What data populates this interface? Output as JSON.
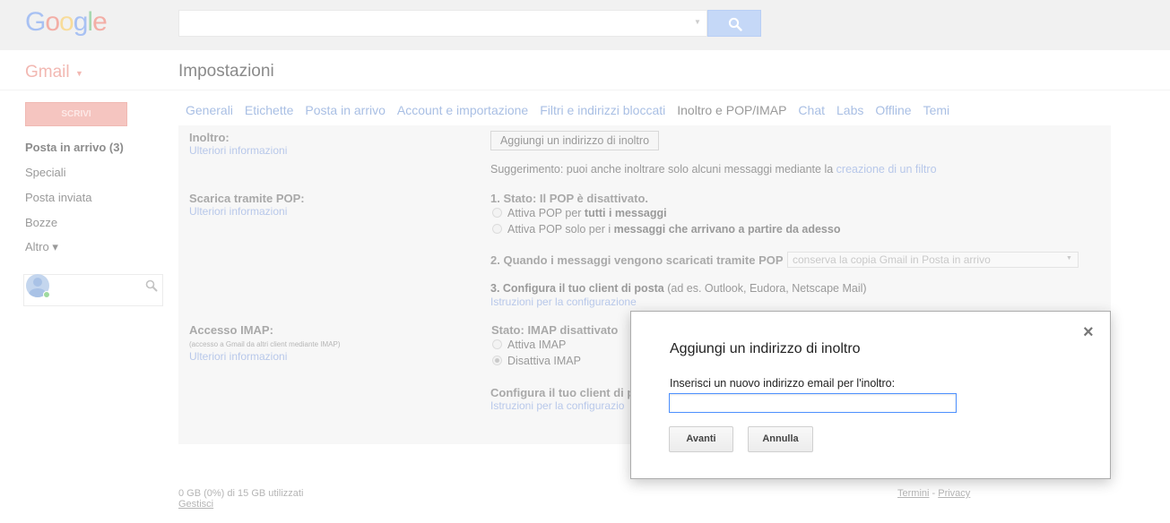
{
  "header": {
    "logo": {
      "text": "Google",
      "letters": [
        {
          "ch": "G",
          "color": "#a8c1f3"
        },
        {
          "ch": "o",
          "color": "#f3aea6"
        },
        {
          "ch": "o",
          "color": "#f8dc9a"
        },
        {
          "ch": "g",
          "color": "#a8c1f3"
        },
        {
          "ch": "l",
          "color": "#a6d8b0"
        },
        {
          "ch": "e",
          "color": "#f3aea6"
        }
      ]
    },
    "search_value": "",
    "search_icon": "search-icon"
  },
  "app": {
    "brand": "Gmail",
    "page_title": "Impostazioni"
  },
  "sidebar": {
    "compose_label": "SCRIVI",
    "items": [
      {
        "label": "Posta in arrivo (3)"
      },
      {
        "label": "Speciali"
      },
      {
        "label": "Posta inviata"
      },
      {
        "label": "Bozze"
      },
      {
        "label": "Altro ▾"
      }
    ]
  },
  "tabs": [
    {
      "label": "Generali"
    },
    {
      "label": "Etichette"
    },
    {
      "label": "Posta in arrivo"
    },
    {
      "label": "Account e importazione"
    },
    {
      "label": "Filtri e indirizzi bloccati"
    },
    {
      "label": "Inoltro e POP/IMAP",
      "active": true
    },
    {
      "label": "Chat"
    },
    {
      "label": "Labs"
    },
    {
      "label": "Offline"
    },
    {
      "label": "Temi"
    }
  ],
  "forwarding": {
    "label": "Inoltro:",
    "learn_more": "Ulteriori informazioni",
    "add_button": "Aggiungi un indirizzo di inoltro",
    "tip_prefix": "Suggerimento: puoi anche inoltrare solo alcuni messaggi mediante la ",
    "tip_link": "creazione di un filtro"
  },
  "pop": {
    "label": "Scarica tramite POP:",
    "learn_more": "Ulteriori informazioni",
    "status": "1. Stato: Il POP è disattivato.",
    "option1_prefix": "Attiva POP per ",
    "option1_bold": "tutti i messaggi",
    "option2_prefix": "Attiva POP solo per i ",
    "option2_bold": "messaggi che arrivano a partire da adesso",
    "step2": "2. Quando i messaggi vengono scaricati tramite POP",
    "step2_select": "conserva la copia Gmail in Posta in arrivo",
    "step3_bold": "3. Configura il tuo client di posta",
    "step3_rest": " (ad es. Outlook, Eudora, Netscape Mail)",
    "step3_link": "Istruzioni per la configurazione"
  },
  "imap": {
    "label": "Accesso IMAP:",
    "sublabel": "(accesso a Gmail da altri client mediante IMAP)",
    "learn_more": "Ulteriori informazioni",
    "status": "Stato: IMAP disattivato",
    "option_enable": "Attiva IMAP",
    "option_disable": "Disattiva IMAP",
    "configure": "Configura il tuo client di p",
    "configure_link": "Istruzioni per la configurazio"
  },
  "footer": {
    "storage": "0 GB (0%) di 15 GB utilizzati",
    "manage": "Gestisci",
    "terms": "Termini",
    "separator": " - ",
    "privacy": "Privacy"
  },
  "dialog": {
    "title": "Aggiungi un indirizzo di inoltro",
    "close_glyph": "×",
    "prompt": "Inserisci un nuovo indirizzo email per l'inoltro:",
    "input_value": "",
    "next_button": "Avanti",
    "cancel_button": "Annulla"
  }
}
